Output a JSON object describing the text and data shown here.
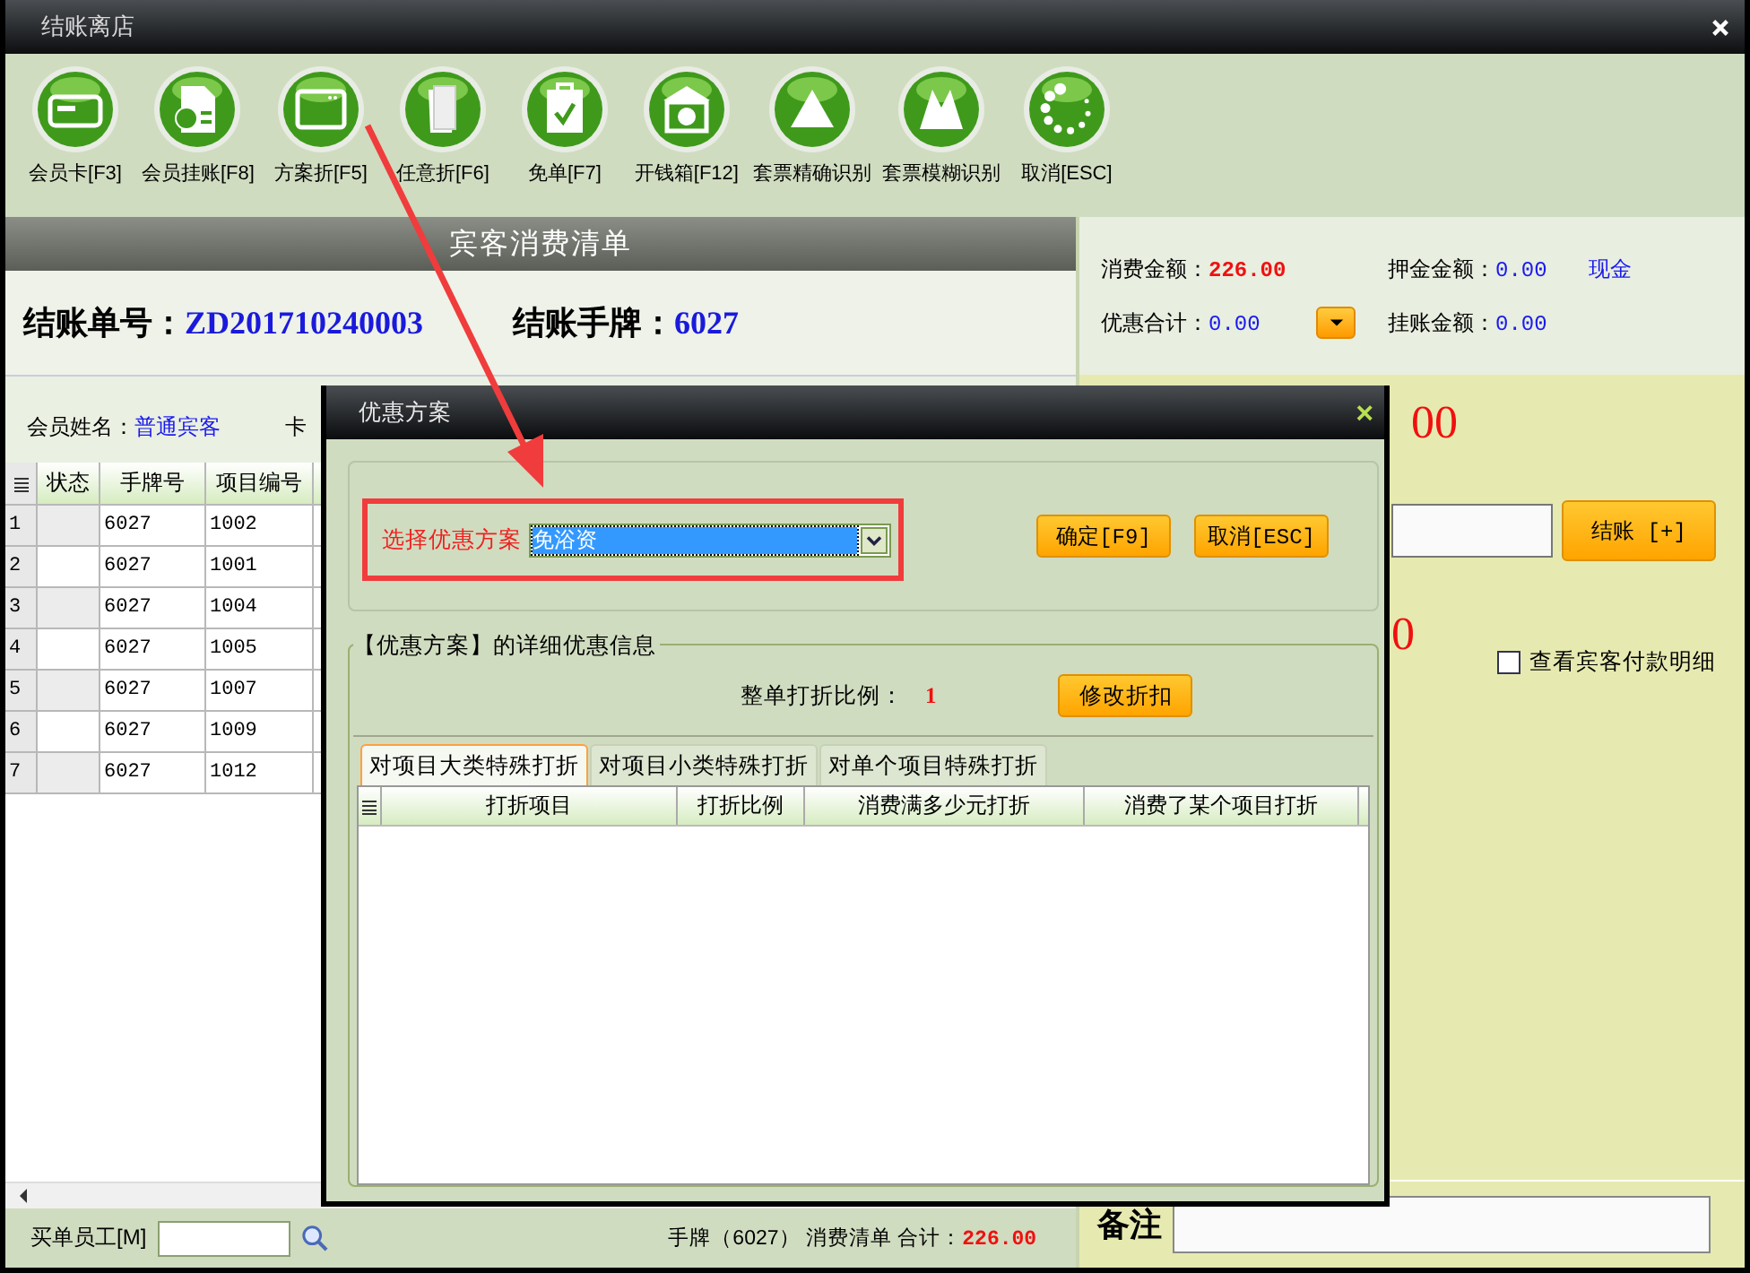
{
  "window": {
    "title": "结账离店"
  },
  "toolbar": [
    {
      "label": "会员卡[F3]",
      "kind": "card"
    },
    {
      "label": "会员挂账[F8]",
      "kind": "doc"
    },
    {
      "label": "方案折[F5]",
      "kind": "window"
    },
    {
      "label": "任意折[F6]",
      "kind": "cards"
    },
    {
      "label": "免单[F7]",
      "kind": "clipboard"
    },
    {
      "label": "开钱箱[F12]",
      "kind": "bank"
    },
    {
      "label": "套票精确识别",
      "kind": "triangle"
    },
    {
      "label": "套票模糊识别",
      "kind": "peaks"
    },
    {
      "label": "取消[ESC]",
      "kind": "spinner"
    }
  ],
  "bill": {
    "header": "宾客消费清单",
    "order_label": "结账单号：",
    "order_no": "ZD201710240003",
    "tag_label": "结账手牌：",
    "tag_no": "6027",
    "member_label": "会员姓名：",
    "member_name": "普通宾客",
    "card_label": "卡"
  },
  "table": {
    "columns": [
      "状态",
      "手牌号",
      "项目编号"
    ],
    "rows": [
      {
        "n": "1",
        "tag": "6027",
        "item": "1002"
      },
      {
        "n": "2",
        "tag": "6027",
        "item": "1001"
      },
      {
        "n": "3",
        "tag": "6027",
        "item": "1004"
      },
      {
        "n": "4",
        "tag": "6027",
        "item": "1005"
      },
      {
        "n": "5",
        "tag": "6027",
        "item": "1007"
      },
      {
        "n": "6",
        "tag": "6027",
        "item": "1009"
      },
      {
        "n": "7",
        "tag": "6027",
        "item": "1012"
      }
    ]
  },
  "footer": {
    "staff_label": "买单员工[M]",
    "summary": "手牌（6027） 消费清单 合计：",
    "total": "226.00"
  },
  "totals": {
    "spend_label": "消费金额：",
    "spend": "226.00",
    "deposit_label": "押金金额：",
    "deposit": "0.00",
    "cash_link": "现金",
    "discount_label": "优惠合计：",
    "discount": "0.00",
    "credit_label": "挂账金额：",
    "credit": "0.00"
  },
  "payment": {
    "big_amount": "00",
    "small_amount": "0",
    "checkout_button": "结账 [+]",
    "detail_checkbox": {
      "label": "查看宾客付款明细",
      "checked": false
    },
    "remark_label": "备注"
  },
  "dialog": {
    "title": "优惠方案",
    "close": "×",
    "select_label": "选择优惠方案",
    "select_value": "免浴资",
    "ok_button": "确定[F9]",
    "cancel_button": "取消[ESC]",
    "group_title": "【优惠方案】的详细优惠信息",
    "ratio_label": "整单打折比例：",
    "ratio": "1",
    "edit_button": "修改折扣",
    "tabs": [
      {
        "label": "对项目大类特殊打折",
        "selected": true
      },
      {
        "label": "对项目小类特殊打折",
        "selected": false
      },
      {
        "label": "对单个项目特殊打折",
        "selected": false
      }
    ],
    "columns": [
      "打折项目",
      "打折比例",
      "消费满多少元打折",
      "消费了某个项目打折"
    ]
  }
}
